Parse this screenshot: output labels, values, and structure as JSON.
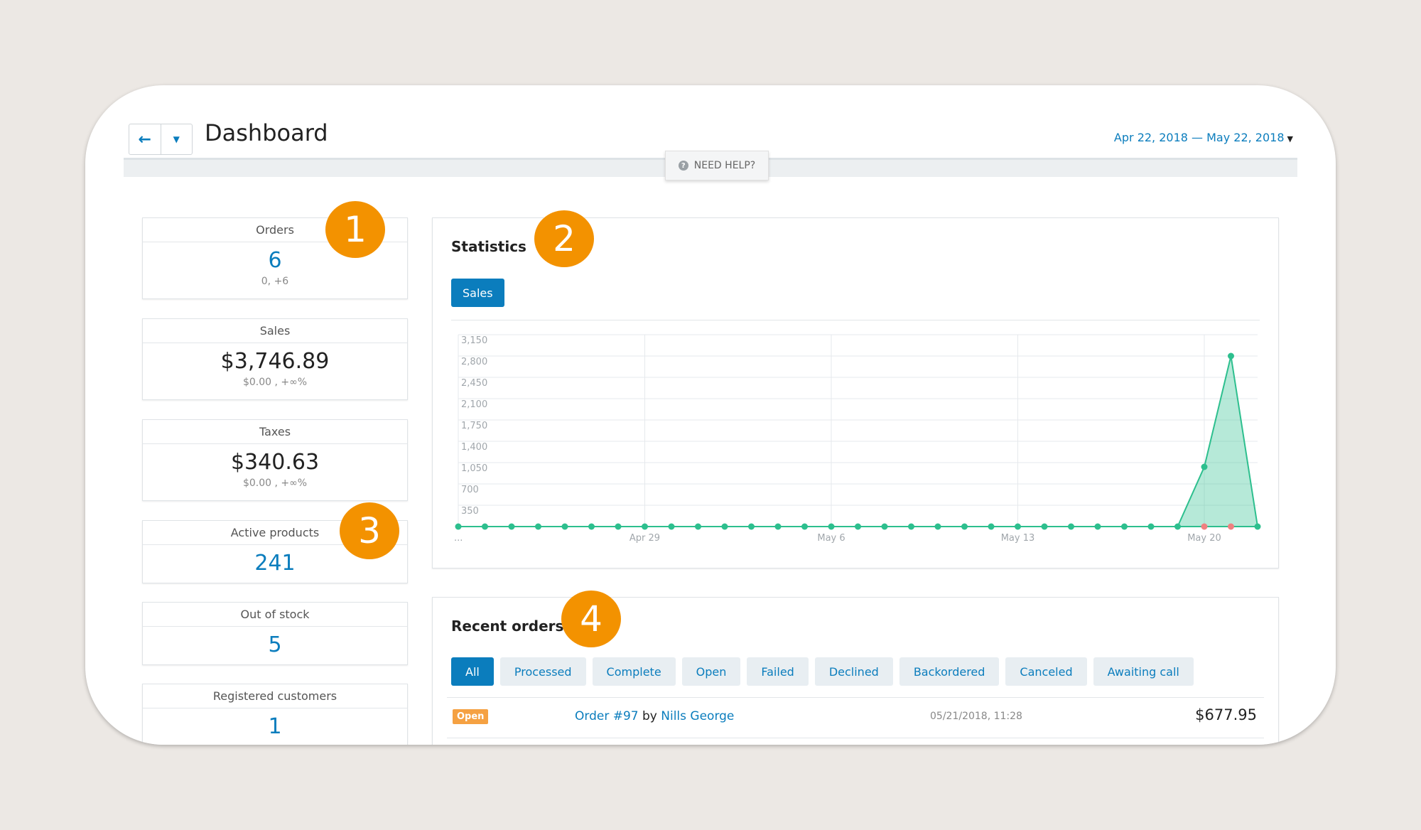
{
  "header": {
    "title": "Dashboard",
    "date_range": "Apr 22, 2018 — May 22, 2018",
    "help": "NEED HELP?"
  },
  "stats": [
    {
      "label": "Orders",
      "value": "6",
      "sub": "0, +6"
    },
    {
      "label": "Sales",
      "value": "$3,746.89",
      "sub": "$0.00 , +∞%"
    },
    {
      "label": "Taxes",
      "value": "$340.63",
      "sub": "$0.00 , +∞%"
    },
    {
      "label": "Active products",
      "value": "241"
    },
    {
      "label": "Out of stock",
      "value": "5"
    },
    {
      "label": "Registered customers",
      "value": "1"
    }
  ],
  "badges": [
    "1",
    "2",
    "3",
    "4"
  ],
  "statistics": {
    "title": "Statistics",
    "tab": "Sales"
  },
  "chart_data": {
    "type": "area",
    "y_ticks": [
      "3,150",
      "2,800",
      "2,450",
      "2,100",
      "1,750",
      "1,400",
      "1,050",
      "700",
      "350"
    ],
    "ylim": [
      0,
      3150
    ],
    "x_labels": [
      "...",
      "Apr 29",
      "May 6",
      "May 13",
      "May 20"
    ],
    "x": [
      "Apr 22",
      "Apr 23",
      "Apr 24",
      "Apr 25",
      "Apr 26",
      "Apr 27",
      "Apr 28",
      "Apr 29",
      "Apr 30",
      "May 1",
      "May 2",
      "May 3",
      "May 4",
      "May 5",
      "May 6",
      "May 7",
      "May 8",
      "May 9",
      "May 10",
      "May 11",
      "May 12",
      "May 13",
      "May 14",
      "May 15",
      "May 16",
      "May 17",
      "May 18",
      "May 19",
      "May 20",
      "May 21",
      "May 22"
    ],
    "series": [
      {
        "color": "#2dbf8e",
        "values": [
          0,
          0,
          0,
          0,
          0,
          0,
          0,
          0,
          0,
          0,
          0,
          0,
          0,
          0,
          0,
          0,
          0,
          0,
          0,
          0,
          0,
          0,
          0,
          0,
          0,
          0,
          0,
          0,
          980,
          2800,
          0
        ]
      },
      {
        "color": "#f08080",
        "values": [
          0,
          0,
          0,
          0,
          0,
          0,
          0,
          0,
          0,
          0,
          0,
          0,
          0,
          0,
          0,
          0,
          0,
          0,
          0,
          0,
          0,
          0,
          0,
          0,
          0,
          0,
          0,
          0,
          0,
          0,
          0
        ]
      }
    ]
  },
  "recent_orders": {
    "title": "Recent orders",
    "filters": [
      "All",
      "Processed",
      "Complete",
      "Open",
      "Failed",
      "Declined",
      "Backordered",
      "Canceled",
      "Awaiting call"
    ],
    "orders": [
      {
        "status": "Open",
        "order": "Order #97",
        "by": "by",
        "customer": "Nills George",
        "date": "05/21/2018, 11:28",
        "total": "$677.95"
      }
    ]
  }
}
